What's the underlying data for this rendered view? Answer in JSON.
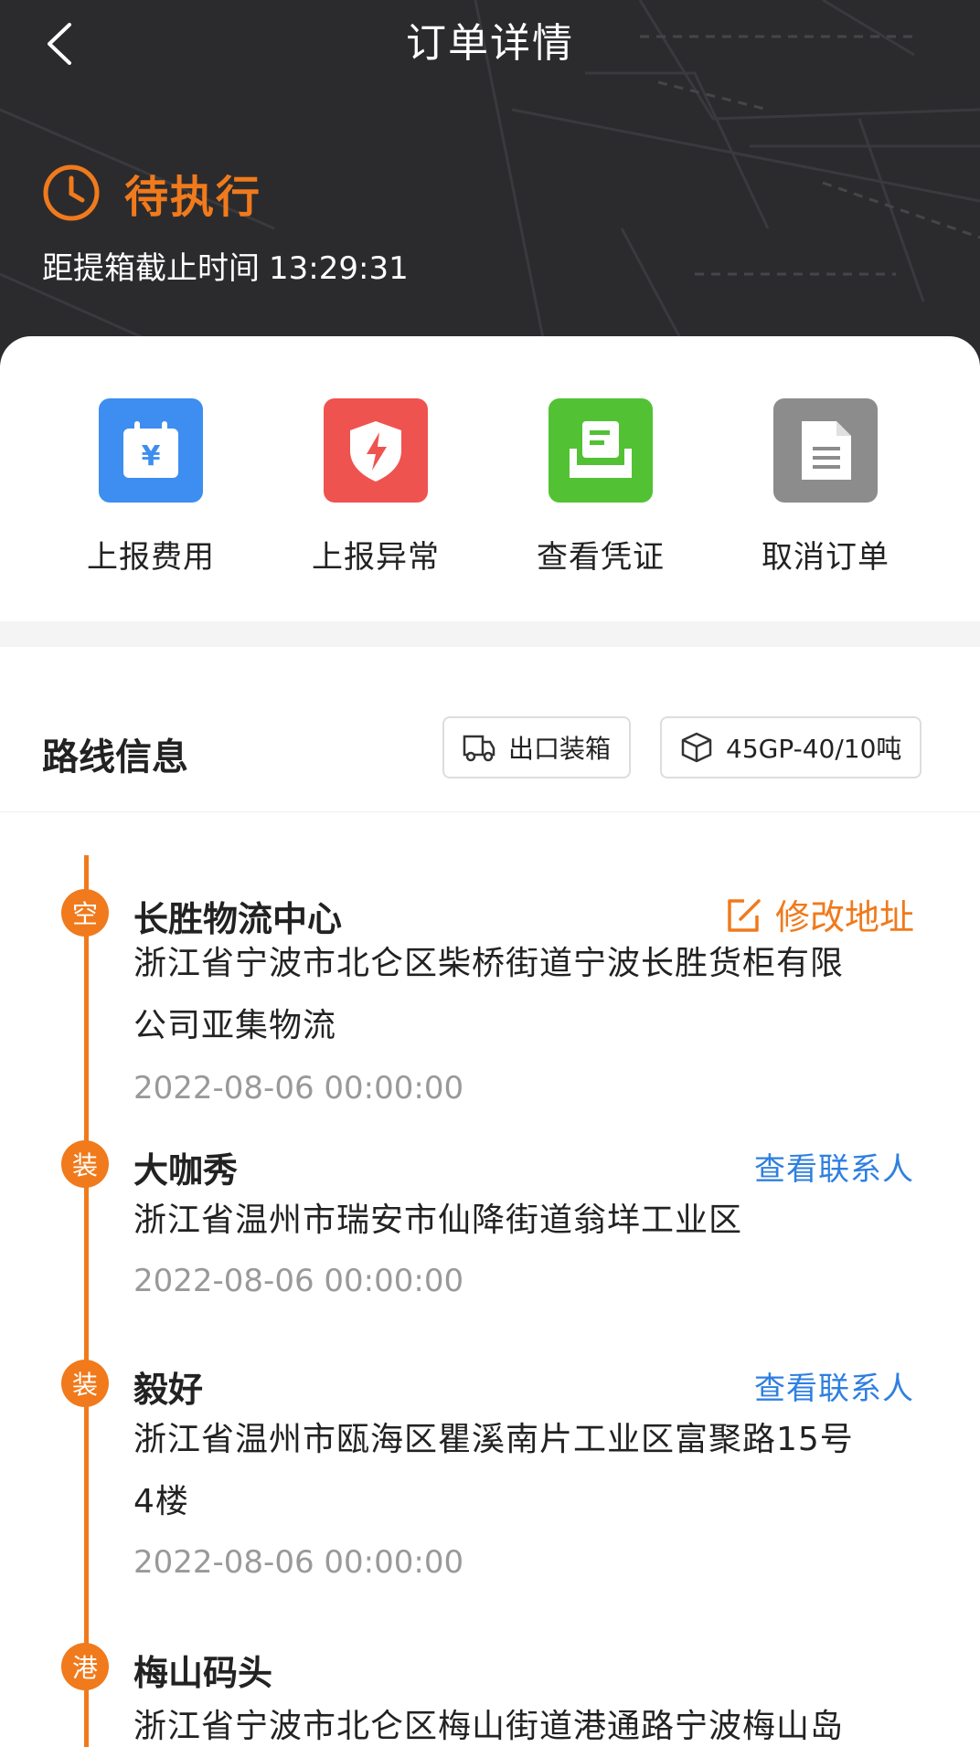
{
  "header": {
    "title": "订单详情",
    "status": "待执行",
    "deadline_label": "距提箱截止时间",
    "deadline_value": "13:29:31"
  },
  "actions": [
    {
      "label": "上报费用",
      "icon": "calendar-yen-icon",
      "color": "#3d8ef0"
    },
    {
      "label": "上报异常",
      "icon": "shield-bolt-icon",
      "color": "#ef5350"
    },
    {
      "label": "查看凭证",
      "icon": "voucher-icon",
      "color": "#52c234"
    },
    {
      "label": "取消订单",
      "icon": "document-icon",
      "color": "#8c8c8c"
    }
  ],
  "route": {
    "title": "路线信息",
    "tags": [
      {
        "label": "出口装箱",
        "icon": "truck-icon"
      },
      {
        "label": "45GP-40/10吨",
        "icon": "box-icon"
      }
    ],
    "stops": [
      {
        "badge": "空",
        "name": "长胜物流中心",
        "action": "修改地址",
        "address_lines": [
          "浙江省宁波市北仑区柴桥街道宁波长胜货柜有限",
          "公司亚集物流"
        ],
        "time": "2022-08-06 00:00:00"
      },
      {
        "badge": "装",
        "name": "大咖秀",
        "action": "查看联系人",
        "address_lines": [
          "浙江省温州市瑞安市仙降街道翁垟工业区"
        ],
        "time": "2022-08-06 00:00:00"
      },
      {
        "badge": "装",
        "name": "毅好",
        "action": "查看联系人",
        "address_lines": [
          "浙江省温州市瓯海区瞿溪南片工业区富聚路15号",
          "4楼"
        ],
        "time": "2022-08-06 00:00:00"
      },
      {
        "badge": "港",
        "name": "梅山码头",
        "action": "",
        "address_lines": [
          "浙江省宁波市北仑区梅山街道港通路宁波梅山岛"
        ],
        "time": ""
      }
    ]
  },
  "colors": {
    "accent": "#f07a1c",
    "link": "#2f7fe0",
    "header_bg": "#2b2b2e"
  }
}
